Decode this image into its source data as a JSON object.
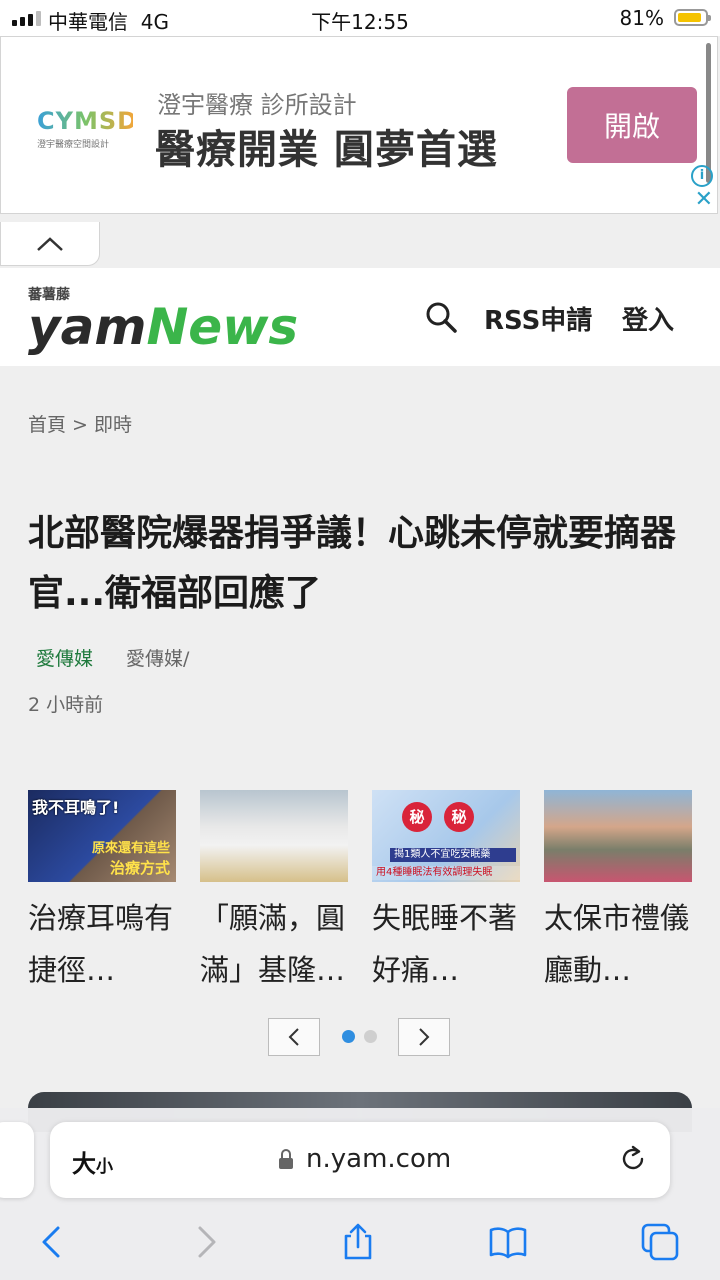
{
  "status_bar": {
    "carrier": "中華電信",
    "network": "4G",
    "time": "下午12:55",
    "battery_pct": "81%",
    "battery_level": 0.81,
    "signal_bars": 3
  },
  "ad": {
    "logo_text": "CYMSD",
    "logo_subtext": "澄宇醫療空間設計",
    "subtitle": "澄宇醫療 診所設計",
    "title": "醫療開業 圓夢首選",
    "button_label": "開啟",
    "info_label": "i",
    "close_label": "✕",
    "accent_color": "#c26f95"
  },
  "site": {
    "logo_top": "蕃薯藤",
    "logo_yam": "yam",
    "logo_news": "News",
    "rss_label": "RSS申請",
    "login_label": "登入"
  },
  "breadcrumb": "首頁 > 即時",
  "article": {
    "headline": "北部醫院爆器捐爭議！心跳未停就要摘器官...衛福部回應了",
    "source": "愛傳媒",
    "author": "愛傳媒/",
    "time": "2 小時前"
  },
  "related": [
    {
      "title": "治療耳鳴有捷徑…",
      "thumb_line1": "我不耳鳴了!",
      "thumb_line2": "原來還有這些",
      "thumb_line3": "治療方式"
    },
    {
      "title": "「願滿，圓滿」基隆…"
    },
    {
      "title": "失眠睡不著好痛…",
      "thumb_badge1": "秘",
      "thumb_badge2": "秘",
      "thumb_bar": "揭1類人不宜吃安眠藥",
      "thumb_bar2": "用4種睡眠法有效調理失眠"
    },
    {
      "title": "太保市禮儀廳動…"
    }
  ],
  "pager": {
    "active_index": 0,
    "total": 2,
    "prev_icon": "chevron-left-icon",
    "next_icon": "chevron-right-icon"
  },
  "browser": {
    "size_label": "大",
    "size_small": "小",
    "url": "n.yam.com"
  }
}
